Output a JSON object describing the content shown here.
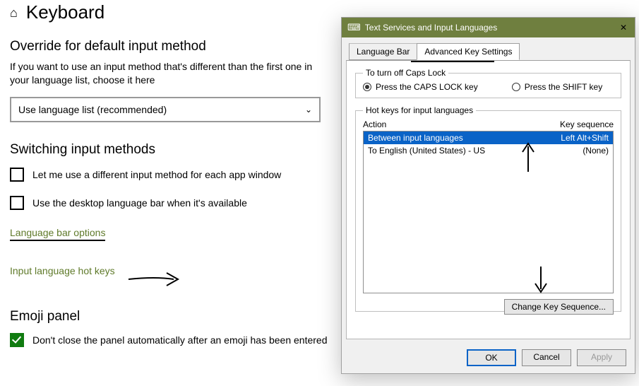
{
  "settings": {
    "page_title": "Keyboard",
    "override_title": "Override for default input method",
    "override_para": "If you want to use an input method that's different than the first one in your language list, choose it here",
    "dropdown_value": "Use language list (recommended)",
    "switch_title": "Switching input methods",
    "chk_per_window": "Let me use a different input method for each app window",
    "chk_desktop_bar": "Use the desktop language bar when it's available",
    "link_bar_options": "Language bar options",
    "link_hotkeys": "Input language hot keys",
    "emoji_title": "Emoji panel",
    "chk_emoji": "Don't close the panel automatically after an emoji has been entered"
  },
  "dialog": {
    "title": "Text Services and Input Languages",
    "tabs": {
      "language_bar": "Language Bar",
      "advanced": "Advanced Key Settings"
    },
    "caps_group": "To turn off Caps Lock",
    "radio_caps": "Press the CAPS LOCK key",
    "radio_shift": "Press the SHIFT key",
    "hotkeys_group": "Hot keys for input languages",
    "col_action": "Action",
    "col_keyseq": "Key sequence",
    "rows": [
      {
        "action": "Between input languages",
        "seq": "Left Alt+Shift"
      },
      {
        "action": "To English (United States) - US",
        "seq": "(None)"
      }
    ],
    "btn_change": "Change Key Sequence...",
    "btn_ok": "OK",
    "btn_cancel": "Cancel",
    "btn_apply": "Apply"
  }
}
